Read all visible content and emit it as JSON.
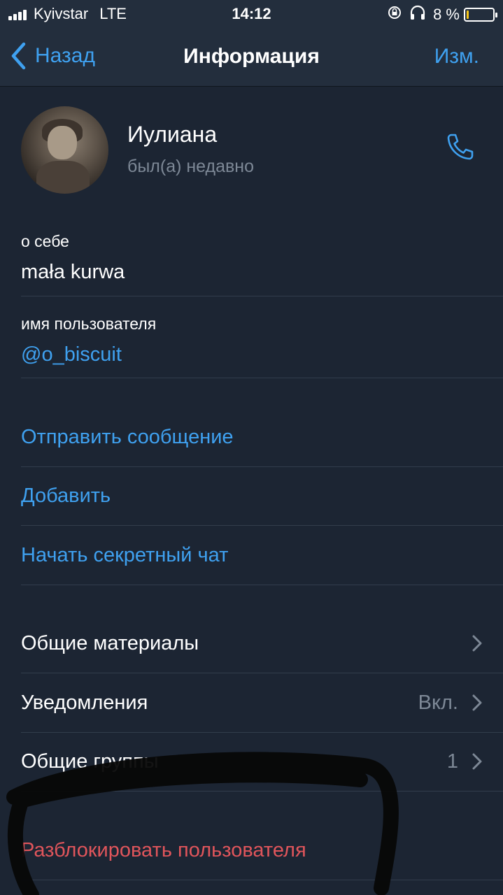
{
  "status_bar": {
    "carrier": "Kyivstar",
    "network": "LTE",
    "time": "14:12",
    "battery_text": "8 %",
    "battery_level": 0.08,
    "icons": [
      "signal-icon",
      "rotation-lock-icon",
      "headphones-icon",
      "battery-icon"
    ]
  },
  "nav": {
    "back_label": "Назад",
    "title": "Информация",
    "edit_label": "Изм."
  },
  "profile": {
    "name": "Иулиана",
    "status": "был(а) недавно"
  },
  "info": {
    "about_label": "о себе",
    "about_value": "mała kurwa",
    "username_label": "имя пользователя",
    "username_value": "@o_biscuit"
  },
  "actions": {
    "send_message": "Отправить сообщение",
    "add": "Добавить",
    "secret_chat": "Начать секретный чат"
  },
  "settings": {
    "shared_media": "Общие материалы",
    "notifications": "Уведомления",
    "notifications_value": "Вкл.",
    "common_groups": "Общие группы",
    "common_groups_value": "1"
  },
  "danger": {
    "unblock": "Разблокировать пользователя"
  },
  "colors": {
    "background": "#1c2533",
    "bar": "#232e3d",
    "accent": "#3fa1f0",
    "danger": "#e0555b",
    "secondary_text": "#7d8896"
  }
}
